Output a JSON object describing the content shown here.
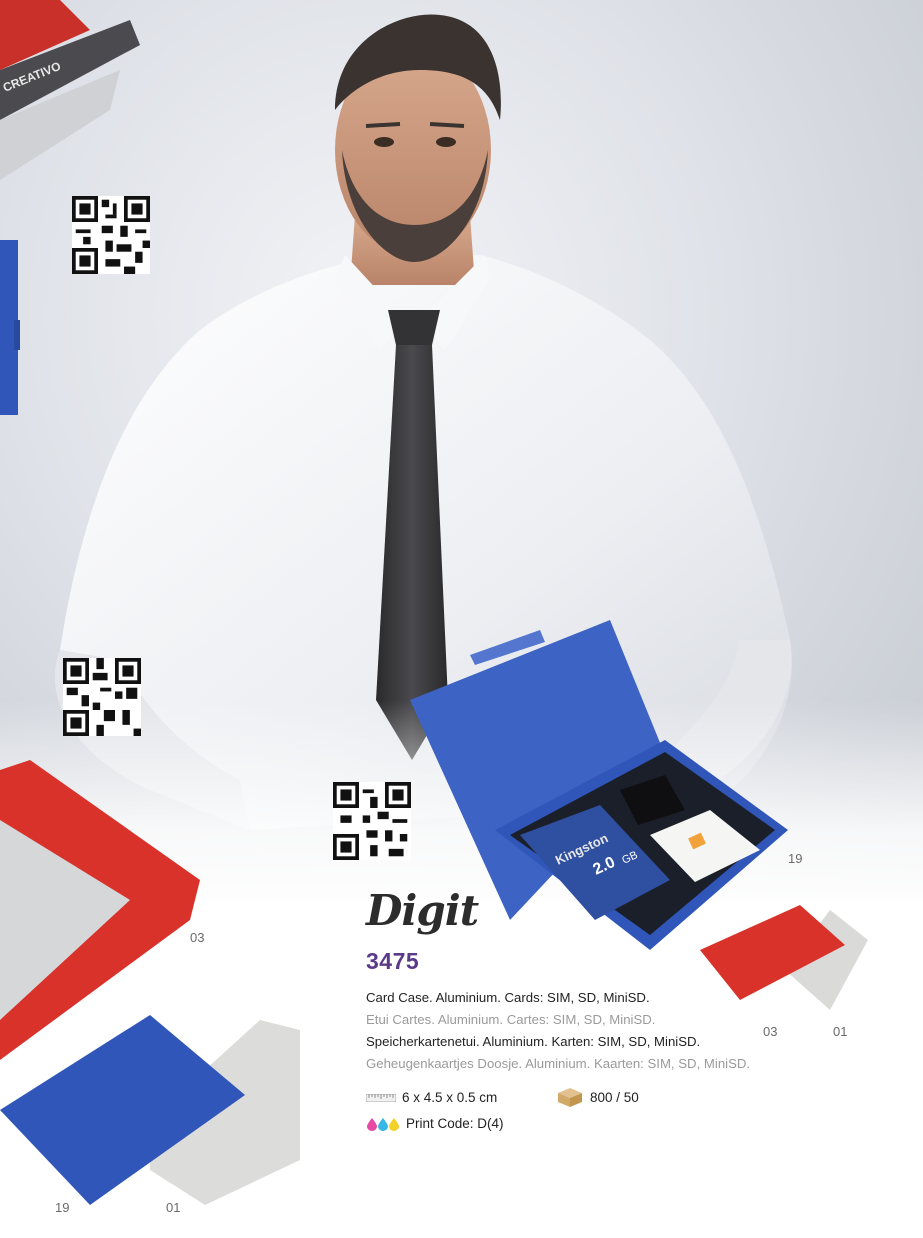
{
  "product": {
    "name": "Digit",
    "code": "3475"
  },
  "descriptions": [
    {
      "lang": "en",
      "text": "Card Case. Aluminium. Cards: SIM, SD, MiniSD."
    },
    {
      "lang": "fr",
      "text": "Etui Cartes. Aluminium. Cartes: SIM, SD, MiniSD."
    },
    {
      "lang": "de",
      "text": "Speicherkartenetui. Aluminium. Karten: SIM, SD, MiniSD."
    },
    {
      "lang": "nl",
      "text": "Geheugenkaartjes Doosje. Aluminium. Kaarten: SIM, SD, MiniSD."
    }
  ],
  "specs": {
    "dimensions": "6 x 4.5 x 0.5 cm",
    "packaging": "800 / 50",
    "print_code": "Print Code: D(4)"
  },
  "color_codes": {
    "main_case": "19",
    "left_red": "03",
    "right_red": "03",
    "right_silver": "01",
    "bottom_blue": "19",
    "bottom_silver": "01"
  },
  "side_card_text": "CREATIVO",
  "sd_card": {
    "brand": "Kingston",
    "capacity": "2.0",
    "unit": "GB"
  },
  "colors": {
    "accent_purple": "#5b3a8a",
    "case_blue": "#2f56b8",
    "case_red": "#d9322b",
    "case_silver": "#d8d8d6"
  }
}
